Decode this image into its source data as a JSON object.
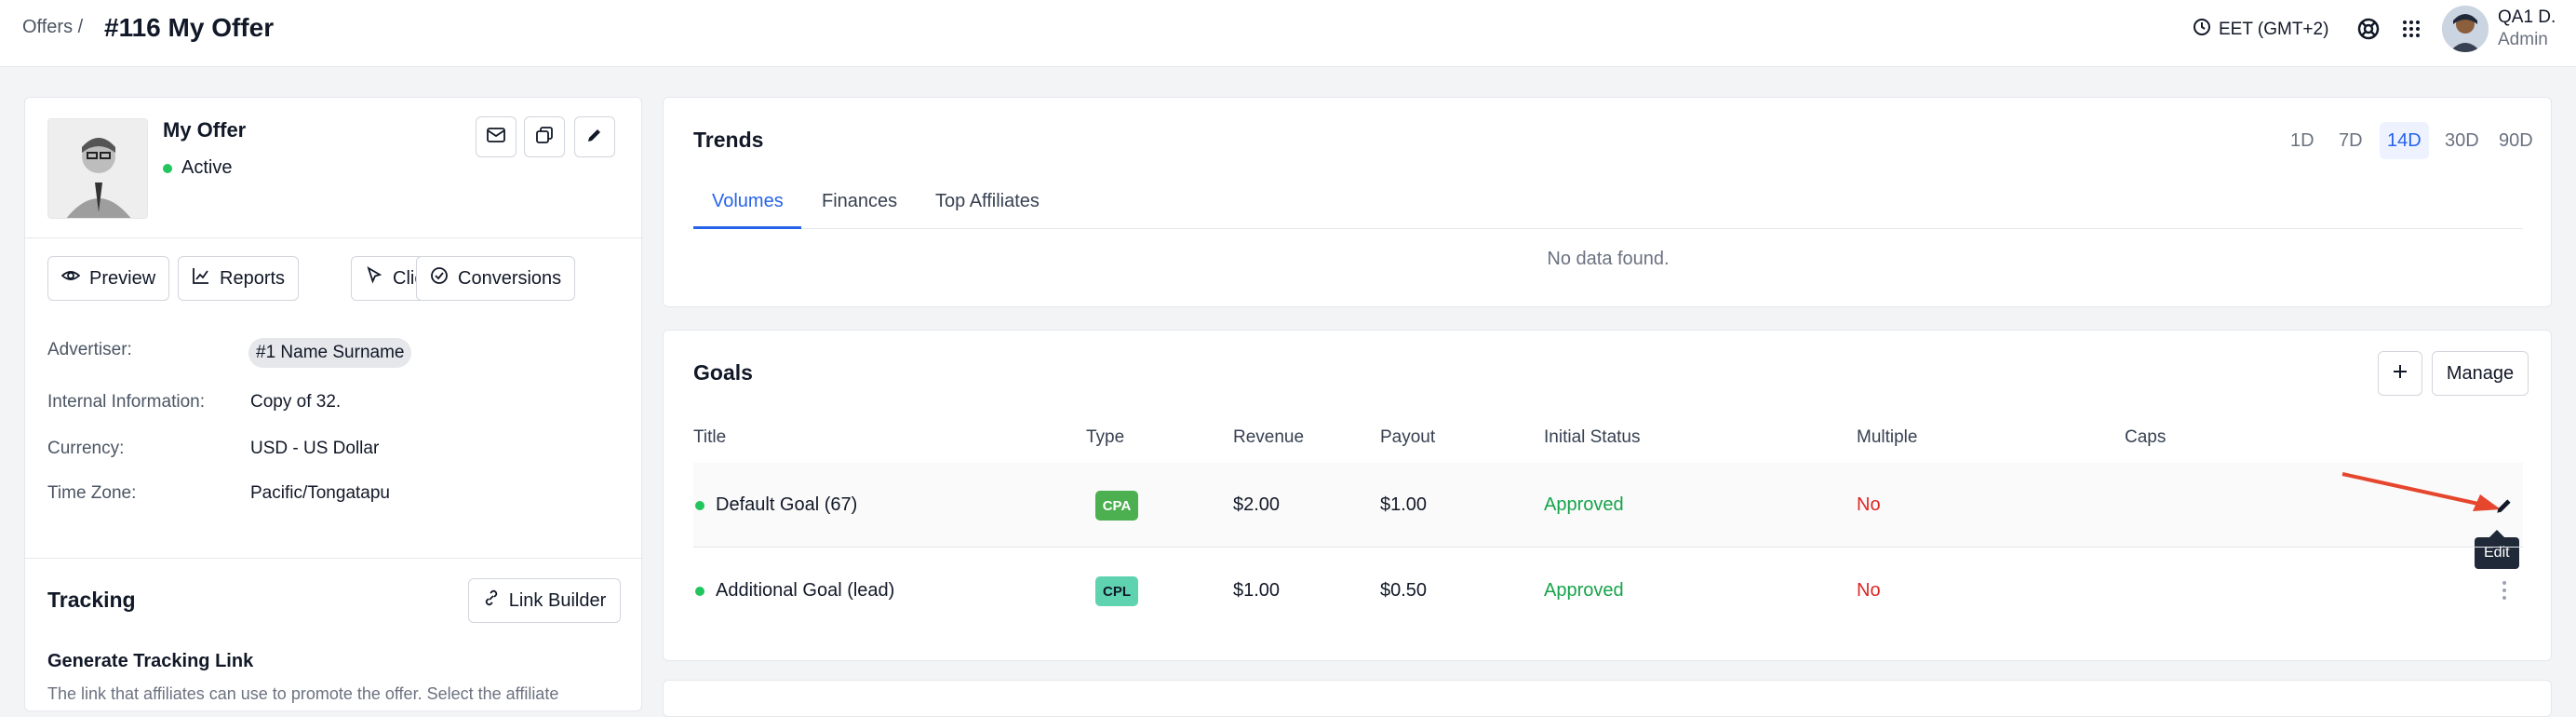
{
  "header": {
    "breadcrumb": "Offers /",
    "title": "#116 My Offer",
    "timezone": "EET (GMT+2)",
    "user_name": "QA1 D.",
    "user_role": "Admin",
    "icons": [
      "clock-icon",
      "support-icon",
      "apps-grid-icon"
    ]
  },
  "offer": {
    "name": "My Offer",
    "status": "Active",
    "status_color": "#22c55e",
    "actions": [
      "mail-icon",
      "copy-icon",
      "pencil-icon"
    ]
  },
  "quick_buttons": [
    {
      "label": "Preview",
      "icon": "eye-icon"
    },
    {
      "label": "Reports",
      "icon": "chart-icon"
    },
    {
      "label": "Clicks",
      "icon": "cursor-icon"
    },
    {
      "label": "Conversions",
      "icon": "check-circle-icon"
    }
  ],
  "info": {
    "advertiser_label": "Advertiser:",
    "advertiser_value": "#1  Name Surname",
    "internal_label": "Internal Information:",
    "internal_value": "Copy of 32.",
    "currency_label": "Currency:",
    "currency_value": "USD - US Dollar",
    "timezone_label": "Time Zone:",
    "timezone_value": "Pacific/Tongatapu"
  },
  "tracking": {
    "title": "Tracking",
    "link_builder": "Link Builder",
    "generate_title": "Generate Tracking Link",
    "generate_desc": "The link that affiliates can use to promote the offer. Select the affiliate"
  },
  "trends": {
    "title": "Trends",
    "ranges": [
      "1D",
      "7D",
      "14D",
      "30D",
      "90D"
    ],
    "active_range": "14D",
    "tabs": [
      "Volumes",
      "Finances",
      "Top Affiliates"
    ],
    "active_tab": "Volumes",
    "empty": "No data found."
  },
  "goals": {
    "title": "Goals",
    "manage": "Manage",
    "columns": [
      "Title",
      "Type",
      "Revenue",
      "Payout",
      "Initial Status",
      "Multiple",
      "Caps"
    ],
    "rows": [
      {
        "title": "Default Goal (67)",
        "type": "CPA",
        "revenue": "$2.00",
        "payout": "$1.00",
        "status": "Approved",
        "multiple": "No",
        "caps": ""
      },
      {
        "title": "Additional Goal (lead)",
        "type": "CPL",
        "revenue": "$1.00",
        "payout": "$0.50",
        "status": "Approved",
        "multiple": "No",
        "caps": ""
      }
    ],
    "tooltip": "Edit",
    "colors": {
      "cpa_bg": "#4caf50",
      "cpl_bg": "#5fd3b0",
      "approved": "#16a34a",
      "no": "#dc2626"
    }
  }
}
